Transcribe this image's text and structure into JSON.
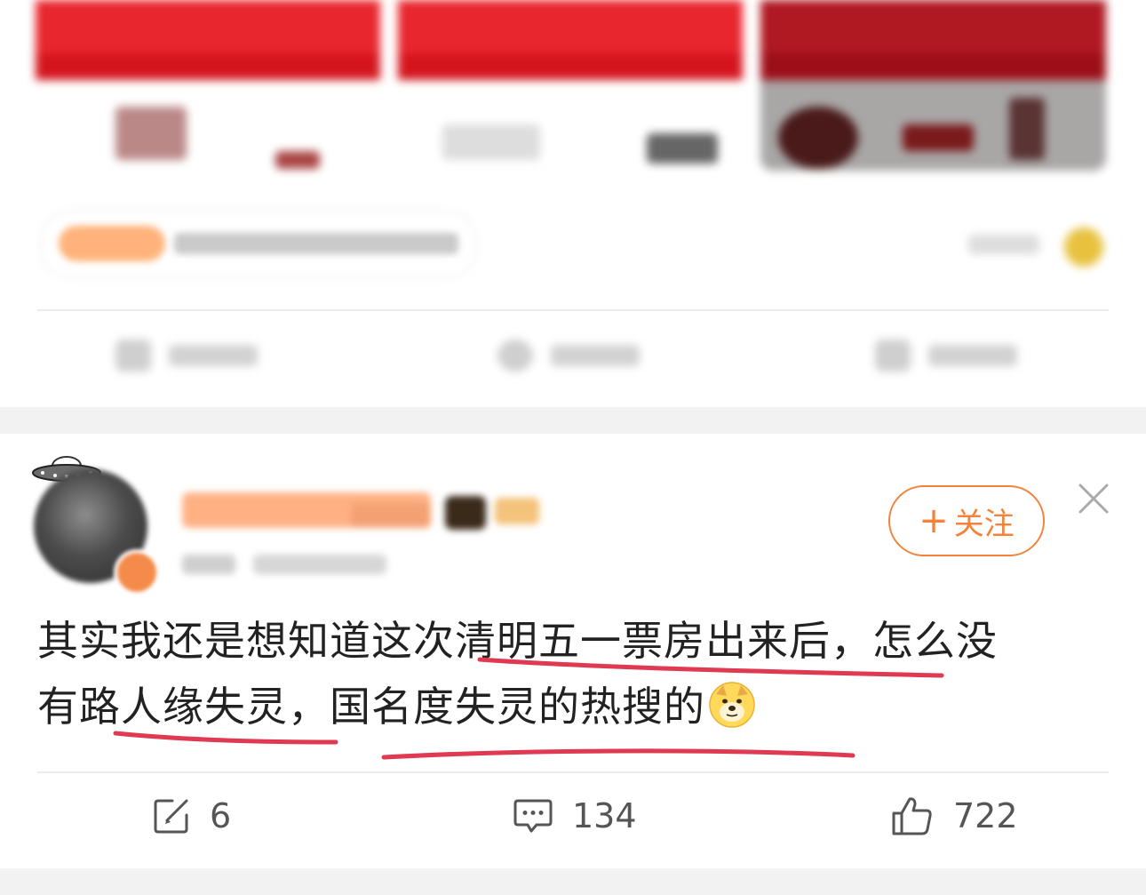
{
  "comment": {
    "follow_label": "关注",
    "follow_plus": "+",
    "content_line1_pre": "其实我还是想知道这次",
    "content_line1_hl": "清明五一票房出来后，",
    "content_line1_post": "怎么没",
    "content_line2_pre": "有路",
    "content_line2_hl1": "人缘失灵，",
    "content_line2_hl2": "国名度失灵的热搜的",
    "emoji_name": "doge-emoji",
    "repost_count": "6",
    "comment_count": "134",
    "like_count": "722"
  },
  "colors": {
    "accent": "#f5823a",
    "underline": "#e03a52",
    "text": "#222222",
    "action_gray": "#555555"
  }
}
